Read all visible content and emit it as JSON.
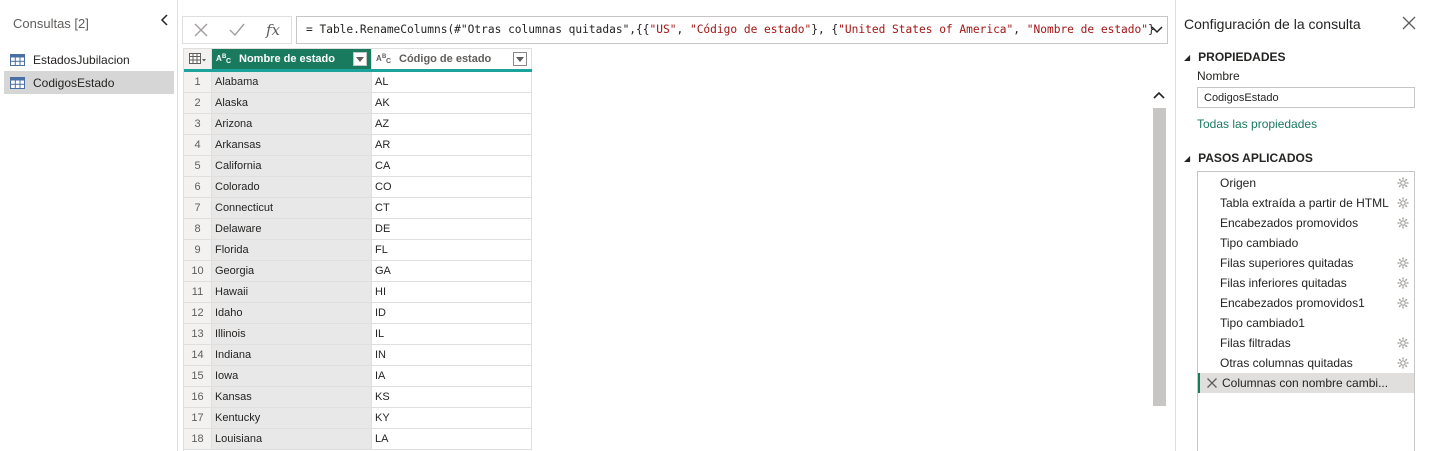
{
  "queries": {
    "header": "Consultas [2]",
    "items": [
      {
        "label": "EstadosJubilacion",
        "selected": false
      },
      {
        "label": "CodigosEstado",
        "selected": true
      }
    ]
  },
  "formula": {
    "prefix": "= Table.RenameColumns(#\"Otras columnas quitadas\",{{",
    "s1": "\"US\"",
    "sep1": ", ",
    "s2": "\"Código de estado\"",
    "sep2": "}, {",
    "s3": "\"United States of America\"",
    "sep3": ", ",
    "s4": "\"Nombre de estado\"",
    "suffix": "}",
    "fx_label": "fx"
  },
  "grid": {
    "columns": [
      {
        "name": "Nombre de estado",
        "type_icon": "ABC"
      },
      {
        "name": "Código de estado",
        "type_icon": "ABC"
      }
    ],
    "rows": [
      {
        "n": "1",
        "a": "Alabama",
        "b": "AL"
      },
      {
        "n": "2",
        "a": "Alaska",
        "b": "AK"
      },
      {
        "n": "3",
        "a": "Arizona",
        "b": "AZ"
      },
      {
        "n": "4",
        "a": "Arkansas",
        "b": "AR"
      },
      {
        "n": "5",
        "a": "California",
        "b": "CA"
      },
      {
        "n": "6",
        "a": "Colorado",
        "b": "CO"
      },
      {
        "n": "7",
        "a": "Connecticut",
        "b": "CT"
      },
      {
        "n": "8",
        "a": "Delaware",
        "b": "DE"
      },
      {
        "n": "9",
        "a": "Florida",
        "b": "FL"
      },
      {
        "n": "10",
        "a": "Georgia",
        "b": "GA"
      },
      {
        "n": "11",
        "a": "Hawaii",
        "b": "HI"
      },
      {
        "n": "12",
        "a": "Idaho",
        "b": "ID"
      },
      {
        "n": "13",
        "a": "Illinois",
        "b": "IL"
      },
      {
        "n": "14",
        "a": "Indiana",
        "b": "IN"
      },
      {
        "n": "15",
        "a": "Iowa",
        "b": "IA"
      },
      {
        "n": "16",
        "a": "Kansas",
        "b": "KS"
      },
      {
        "n": "17",
        "a": "Kentucky",
        "b": "KY"
      },
      {
        "n": "18",
        "a": "Louisiana",
        "b": "LA"
      }
    ]
  },
  "settings": {
    "title": "Configuración de la consulta",
    "properties_header": "PROPIEDADES",
    "name_label": "Nombre",
    "name_value": "CodigosEstado",
    "all_properties_link": "Todas las propiedades",
    "steps_header": "PASOS APLICADOS",
    "steps": [
      {
        "label": "Origen",
        "gear": true,
        "selected": false
      },
      {
        "label": "Tabla extraída a partir de HTML",
        "gear": true,
        "selected": false
      },
      {
        "label": "Encabezados promovidos",
        "gear": true,
        "selected": false
      },
      {
        "label": "Tipo cambiado",
        "gear": false,
        "selected": false
      },
      {
        "label": "Filas superiores quitadas",
        "gear": true,
        "selected": false
      },
      {
        "label": "Filas inferiores quitadas",
        "gear": true,
        "selected": false
      },
      {
        "label": "Encabezados promovidos1",
        "gear": true,
        "selected": false
      },
      {
        "label": "Tipo cambiado1",
        "gear": false,
        "selected": false
      },
      {
        "label": "Filas filtradas",
        "gear": true,
        "selected": false
      },
      {
        "label": "Otras columnas quitadas",
        "gear": true,
        "selected": false
      },
      {
        "label": "Columnas con nombre cambi...",
        "gear": false,
        "selected": true
      }
    ]
  },
  "colors": {
    "accent": "#1a7a5e",
    "teal_underline": "#1ba39c",
    "string_literal": "#a31515"
  }
}
